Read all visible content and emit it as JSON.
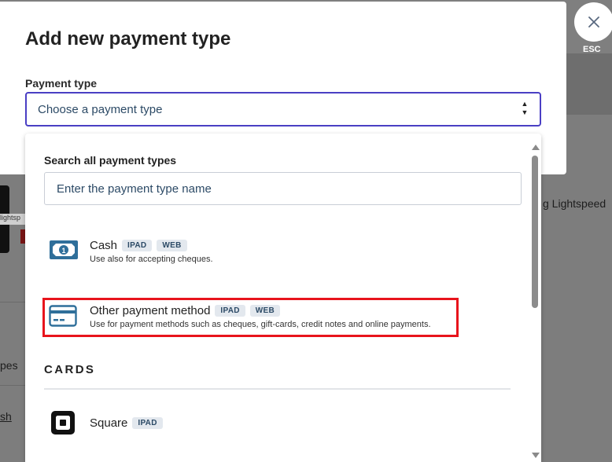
{
  "background": {
    "partial_text_right": "g Lightspeed",
    "partial_text_left_1": "pes",
    "partial_text_left_2": "sh",
    "thumb_label": "lightsp"
  },
  "modal": {
    "title": "Add new payment type",
    "field_label": "Payment type",
    "select_value": "Choose a payment type",
    "close_label": "ESC"
  },
  "dropdown": {
    "search_label": "Search all payment types",
    "search_placeholder": "Enter the payment type name",
    "options": [
      {
        "name": "Cash",
        "badges": [
          "IPAD",
          "WEB"
        ],
        "description": "Use also for accepting cheques.",
        "icon": "cash-icon"
      },
      {
        "name": "Other payment method",
        "badges": [
          "IPAD",
          "WEB"
        ],
        "description": "Use for payment methods such as cheques, gift-cards, credit notes and online payments.",
        "icon": "credit-card-icon",
        "highlighted": true
      }
    ],
    "cards_heading": "CARDS",
    "card_options": [
      {
        "name": "Square",
        "badges": [
          "IPAD"
        ],
        "icon": "square-logo-icon"
      }
    ]
  },
  "colors": {
    "accent": "#4a3fc4",
    "highlight": "#e8141c",
    "badge_bg": "#e3e8ee",
    "overlay": "#7f7f7f"
  }
}
